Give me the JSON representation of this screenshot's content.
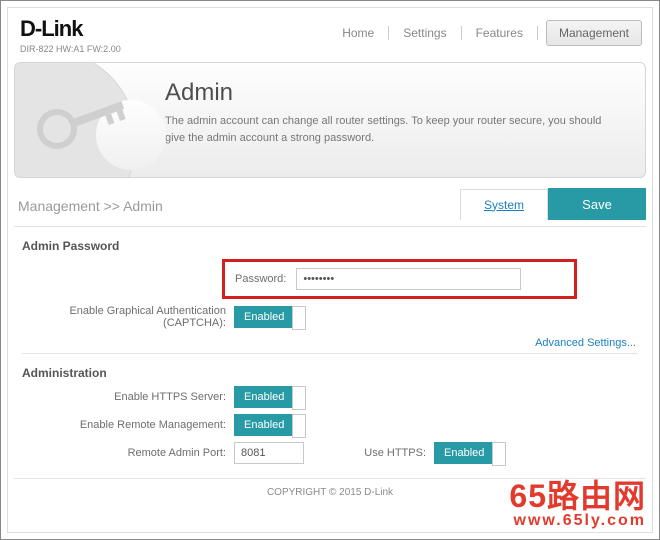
{
  "brand": {
    "name": "D-Link",
    "model": "DIR-822 HW:A1 FW:2.00"
  },
  "nav": {
    "home": "Home",
    "settings": "Settings",
    "features": "Features",
    "management": "Management"
  },
  "banner": {
    "title": "Admin",
    "desc": "The admin account can change all router settings. To keep your router secure, you should give the admin account a strong password."
  },
  "breadcrumb": "Management >> Admin",
  "actions": {
    "system": "System",
    "save": "Save",
    "advanced": "Advanced Settings..."
  },
  "sections": {
    "admin_password": "Admin Password",
    "administration": "Administration"
  },
  "labels": {
    "password": "Password:",
    "captcha": "Enable Graphical Authentication (CAPTCHA):",
    "https_server": "Enable HTTPS Server:",
    "remote_mgmt": "Enable Remote Management:",
    "remote_port": "Remote Admin Port:",
    "use_https": "Use HTTPS:"
  },
  "values": {
    "password": "••••••••",
    "captcha": "Enabled",
    "https_server": "Enabled",
    "remote_mgmt": "Enabled",
    "remote_port": "8081",
    "use_https": "Enabled"
  },
  "footer": "COPYRIGHT © 2015 D-Link",
  "watermark": {
    "big": "65路由网",
    "url": "www.65ly.com"
  }
}
